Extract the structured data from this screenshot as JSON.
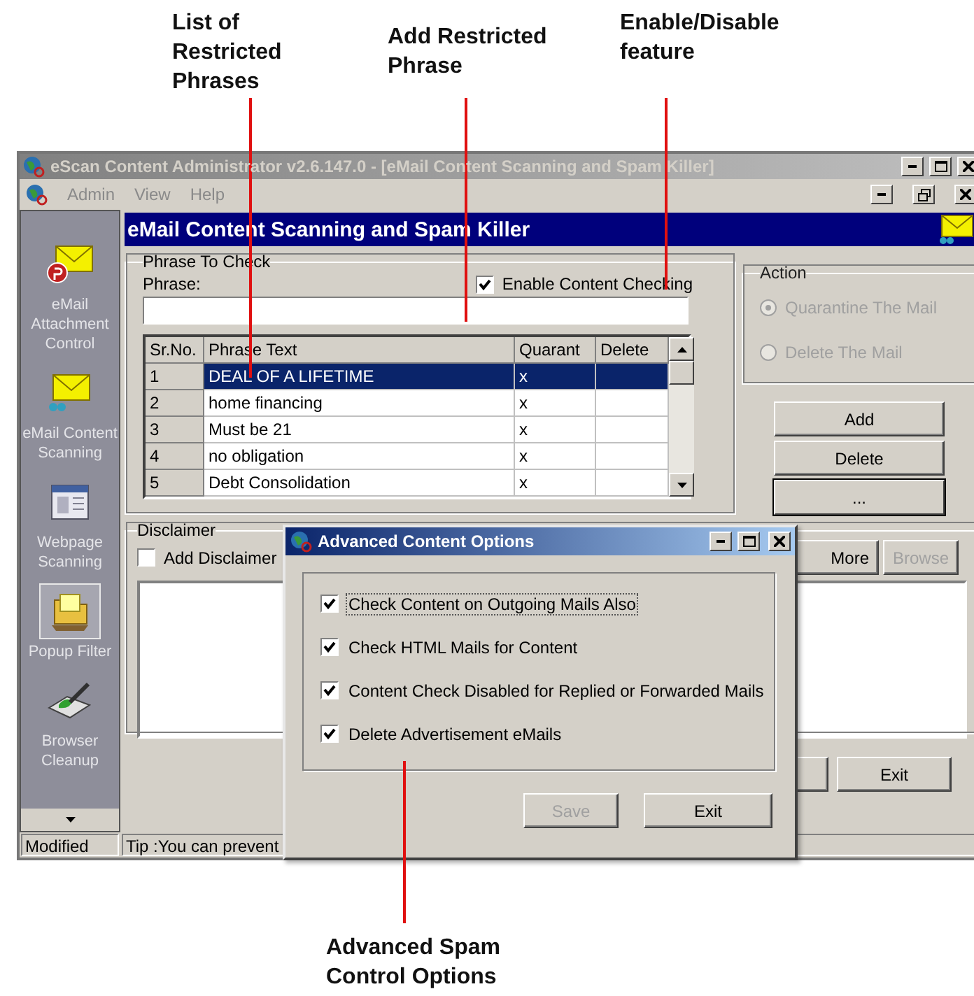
{
  "callouts": [
    {
      "label": "List of\nRestricted\nPhrases"
    },
    {
      "label": "Add Restricted\nPhrase"
    },
    {
      "label": "Enable/Disable\nfeature"
    },
    {
      "label": "Advanced Spam\nControl Options"
    }
  ],
  "window": {
    "title": "eScan Content Administrator v2.6.147.0 - [eMail Content Scanning and Spam Killer]",
    "active": false
  },
  "menu": [
    {
      "label": "Admin",
      "disabled": true
    },
    {
      "label": "View",
      "disabled": true
    },
    {
      "label": "Help",
      "disabled": true
    }
  ],
  "sidebar": {
    "items": [
      {
        "label": "eMail Attachment Control",
        "kind": "attachment",
        "highlighted": false
      },
      {
        "label": "eMail Content Scanning",
        "kind": "content",
        "highlighted": false
      },
      {
        "label": "Webpage Scanning",
        "kind": "webpage",
        "highlighted": false
      },
      {
        "label": "Popup Filter",
        "kind": "popup",
        "highlighted": true
      },
      {
        "label": "Browser Cleanup",
        "kind": "cleanup",
        "highlighted": false
      }
    ]
  },
  "header": {
    "title": "eMail Content Scanning and Spam Killer"
  },
  "phrase_group": {
    "title": "Phrase To Check",
    "phrase_label": "Phrase:",
    "enable_checkbox": {
      "label": "Enable Content Checking",
      "checked": true
    }
  },
  "table": {
    "columns": [
      "Sr.No.",
      "Phrase Text",
      "Quarant",
      "Delete"
    ],
    "rows": [
      {
        "no": "1",
        "phrase": "DEAL OF A LIFETIME",
        "quarantine": "x",
        "selected": true
      },
      {
        "no": "2",
        "phrase": "home financing",
        "quarantine": "x",
        "selected": false
      },
      {
        "no": "3",
        "phrase": "Must be 21",
        "quarantine": "x",
        "selected": false
      },
      {
        "no": "4",
        "phrase": "no obligation",
        "quarantine": "x",
        "selected": false
      },
      {
        "no": "5",
        "phrase": "Debt Consolidation",
        "quarantine": "x",
        "selected": false
      }
    ]
  },
  "action": {
    "title": "Action",
    "disabled": true,
    "options": [
      {
        "label": "Quarantine The Mail",
        "selected": true
      },
      {
        "label": "Delete The Mail",
        "selected": false
      }
    ]
  },
  "buttons": [
    {
      "label": "Add",
      "default": false
    },
    {
      "label": "Delete",
      "default": false
    },
    {
      "label": "...",
      "default": true
    }
  ],
  "disclaimer": {
    "title": "Disclaimer",
    "checkbox": {
      "label": "Add Disclaimer",
      "checked": false
    },
    "buttons": [
      {
        "label": "More",
        "disabled": false
      },
      {
        "label": "Browse",
        "disabled": true
      }
    ]
  },
  "bottom_buttons": [
    {
      "label": "Exit"
    }
  ],
  "status_bar": [
    "Modified",
    "Tip :You can prevent"
  ],
  "dialog": {
    "title": "Advanced Content Options",
    "options": [
      {
        "label": "Check Content on Outgoing Mails Also",
        "checked": true,
        "focused": true
      },
      {
        "label": "Check HTML Mails for Content",
        "checked": true,
        "focused": false
      },
      {
        "label": "Content Check Disabled for Replied or Forwarded Mails",
        "checked": true,
        "focused": false
      },
      {
        "label": "Delete Advertisement eMails",
        "checked": true,
        "focused": false
      }
    ],
    "buttons": [
      {
        "label": "Save",
        "disabled": true
      },
      {
        "label": "Exit",
        "disabled": false
      }
    ]
  }
}
